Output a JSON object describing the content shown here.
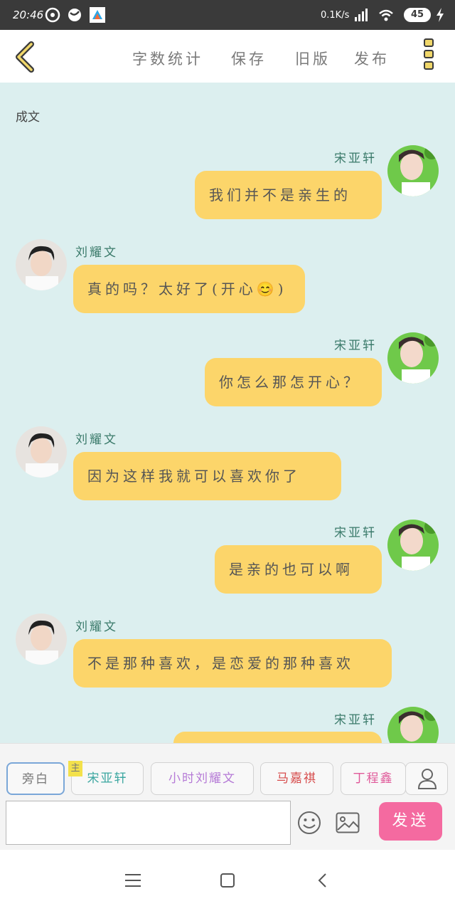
{
  "status_bar": {
    "time": "20:46",
    "net_speed": "0.1K/s",
    "battery": "45"
  },
  "header": {
    "buttons": [
      "字数统计",
      "保存",
      "旧版",
      "发布"
    ]
  },
  "chat": {
    "narration": "成文",
    "messages": [
      {
        "side": "right",
        "name": "宋亚轩",
        "text": "我们并不是亲生的"
      },
      {
        "side": "left",
        "name": "刘耀文",
        "text": "真的吗？太好了(开心😊)"
      },
      {
        "side": "right",
        "name": "宋亚轩",
        "text": "你怎么那怎开心？"
      },
      {
        "side": "left",
        "name": "刘耀文",
        "text": "因为这样我就可以喜欢你了"
      },
      {
        "side": "right",
        "name": "宋亚轩",
        "text": "是亲的也可以啊"
      },
      {
        "side": "left",
        "name": "刘耀文",
        "text": "不是那种喜欢，是恋爱的那种喜欢"
      },
      {
        "side": "right",
        "name": "宋亚轩",
        "text": ""
      }
    ]
  },
  "input_bar": {
    "roles": [
      "旁白",
      "宋亚轩",
      "小时刘耀文",
      "马嘉祺",
      "丁程鑫"
    ],
    "main_tag": "主",
    "input_value": "",
    "send_label": "发送"
  },
  "colors": {
    "bubble": "#fcd56a",
    "background": "#dcefef",
    "send": "#f46aa0"
  }
}
